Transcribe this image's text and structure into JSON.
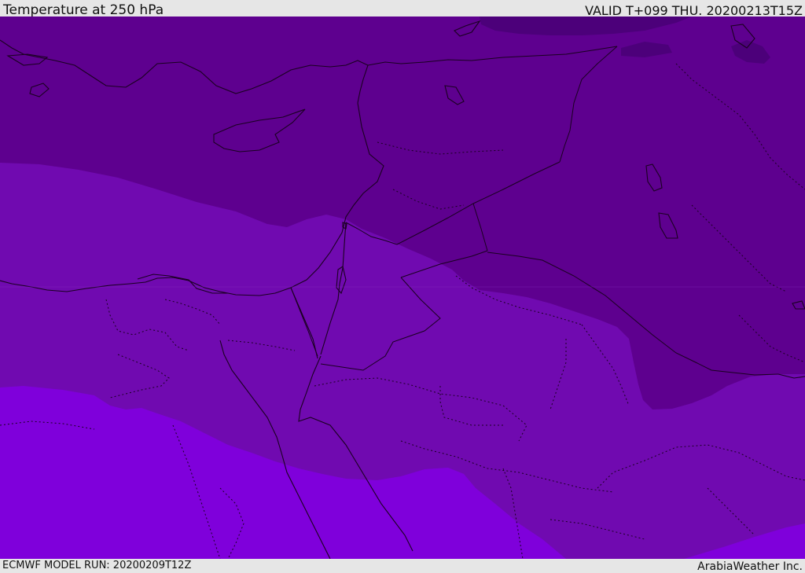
{
  "header": {
    "title": "Temperature at 250 hPa",
    "valid_time": "VALID T+099 THU. 20200213T15Z"
  },
  "footer": {
    "model_run": "ECMWF MODEL RUN: 20200209T12Z",
    "credit": "ArabiaWeather Inc."
  },
  "colors": {
    "band_coldest": "#4c007a",
    "band_cold": "#5e008f",
    "band_mid": "#700ab0",
    "band_warm": "#7f00db",
    "border_line": "#1a0020",
    "background_bar": "#e6e6e6"
  },
  "map_meta": {
    "parameter": "Temperature",
    "level_hpa": 250,
    "projection": "regional-middle-east"
  }
}
